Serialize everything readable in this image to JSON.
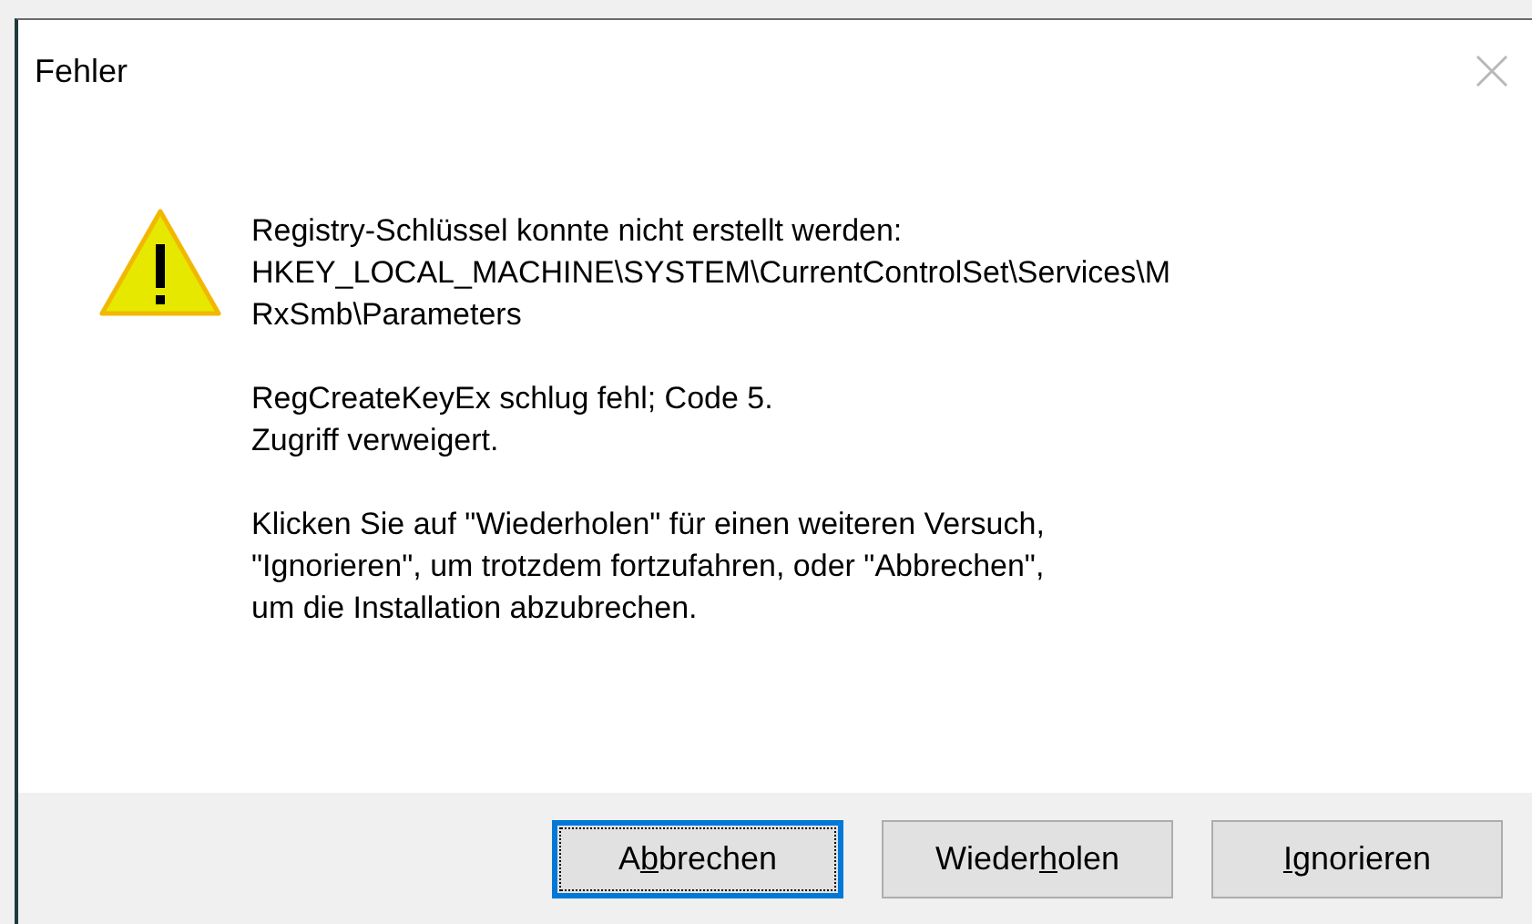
{
  "window": {
    "title": "Fehler"
  },
  "message": {
    "paragraphs": [
      [
        "Registry-Schlüssel konnte nicht erstellt werden:",
        "HKEY_LOCAL_MACHINE\\SYSTEM\\CurrentControlSet\\Services\\M",
        "RxSmb\\Parameters"
      ],
      [
        "RegCreateKeyEx schlug fehl; Code 5.",
        "Zugriff verweigert."
      ],
      [
        "Klicken Sie auf \"Wiederholen\" für einen weiteren Versuch,",
        "\"Ignorieren\", um trotzdem fortzufahren, oder \"Abbrechen\",",
        "um die Installation abzubrechen."
      ]
    ]
  },
  "buttons": [
    {
      "before": "A",
      "key": "b",
      "after": "brechen",
      "default": true
    },
    {
      "before": "Wieder",
      "key": "h",
      "after": "olen",
      "default": false
    },
    {
      "key": "I",
      "after": "gnorieren",
      "default": false
    }
  ]
}
